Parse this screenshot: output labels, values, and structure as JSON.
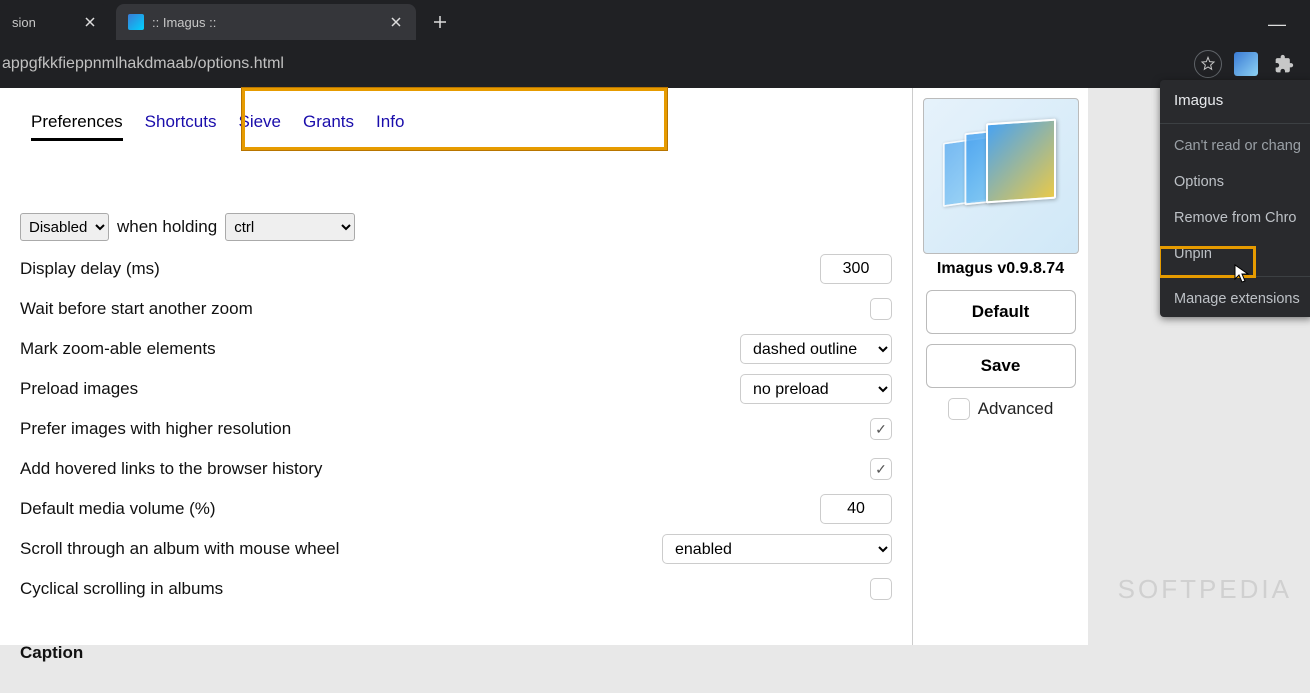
{
  "browser": {
    "tabs": [
      {
        "title": "sion"
      },
      {
        "title": ":: Imagus ::"
      }
    ],
    "address": "appgfkkfieppnmlhakdmaab/options.html"
  },
  "nav": {
    "preferences": "Preferences",
    "shortcuts": "Shortcuts",
    "sieve": "Sieve",
    "grants": "Grants",
    "info": "Info"
  },
  "settings": {
    "hover_mode": "Disabled",
    "when_holding": "when holding",
    "modifier": "ctrl",
    "display_delay_label": "Display delay (ms)",
    "display_delay_value": "300",
    "wait_zoom_label": "Wait before start another zoom",
    "mark_zoom_label": "Mark zoom-able elements",
    "mark_zoom_value": "dashed outline",
    "preload_label": "Preload images",
    "preload_value": "no preload",
    "prefer_hires_label": "Prefer images with higher resolution",
    "prefer_hires_checked": true,
    "add_history_label": "Add hovered links to the browser history",
    "add_history_checked": true,
    "volume_label": "Default media volume (%)",
    "volume_value": "40",
    "scroll_album_label": "Scroll through an album with mouse wheel",
    "scroll_album_value": "enabled",
    "cyclical_label": "Cyclical scrolling in albums",
    "caption_head": "Caption"
  },
  "sidebar": {
    "title": "Imagus v0.9.8.74",
    "default_btn": "Default",
    "save_btn": "Save",
    "advanced_label": "Advanced"
  },
  "ext_menu": {
    "title": "Imagus",
    "cant_read": "Can't read or chang",
    "options": "Options",
    "remove": "Remove from Chro",
    "unpin": "Unpin",
    "manage": "Manage extensions"
  },
  "watermark": "SOFTPEDIA"
}
